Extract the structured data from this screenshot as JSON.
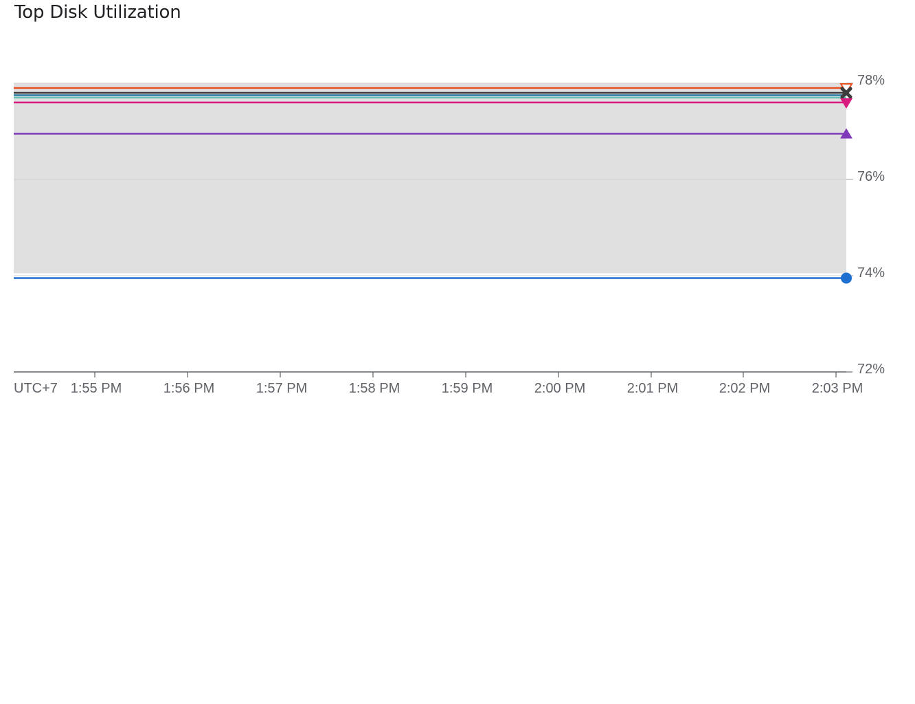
{
  "title": "Top Disk Utilization",
  "chart_data": {
    "type": "line",
    "title": "Top Disk Utilization",
    "xlabel": "",
    "ylabel": "",
    "timezone_label": "UTC+7",
    "x_tick_labels": [
      "1:55 PM",
      "1:56 PM",
      "1:57 PM",
      "1:58 PM",
      "1:59 PM",
      "2:00 PM",
      "2:01 PM",
      "2:02 PM",
      "2:03 PM"
    ],
    "x": [
      "1:54:07 PM",
      "2:03:07 PM"
    ],
    "y_tick_labels": [
      "72%",
      "74%",
      "76%",
      "78%"
    ],
    "ylim": [
      72,
      78
    ],
    "band": {
      "min": 74.05,
      "max": 78.0,
      "color": "#e0e0e0"
    },
    "series": [
      {
        "color": "#e8501f",
        "marker": "triangle-down-outline",
        "values": [
          77.9,
          77.9
        ]
      },
      {
        "color": "#3c3c3c",
        "marker": "x",
        "values": [
          77.8,
          77.8
        ]
      },
      {
        "color": "#2a7ea6",
        "marker": "none",
        "values": [
          77.75,
          77.75
        ]
      },
      {
        "color": "#66c2b4",
        "marker": "none",
        "values": [
          77.7,
          77.7
        ]
      },
      {
        "color": "#d81b7e",
        "marker": "triangle-down",
        "values": [
          77.6,
          77.6
        ]
      },
      {
        "color": "#7e3ab8",
        "marker": "triangle-up",
        "values": [
          76.95,
          76.95
        ]
      },
      {
        "color": "#1e6fd0",
        "marker": "circle",
        "values": [
          73.95,
          73.95
        ]
      }
    ],
    "grid": true
  }
}
